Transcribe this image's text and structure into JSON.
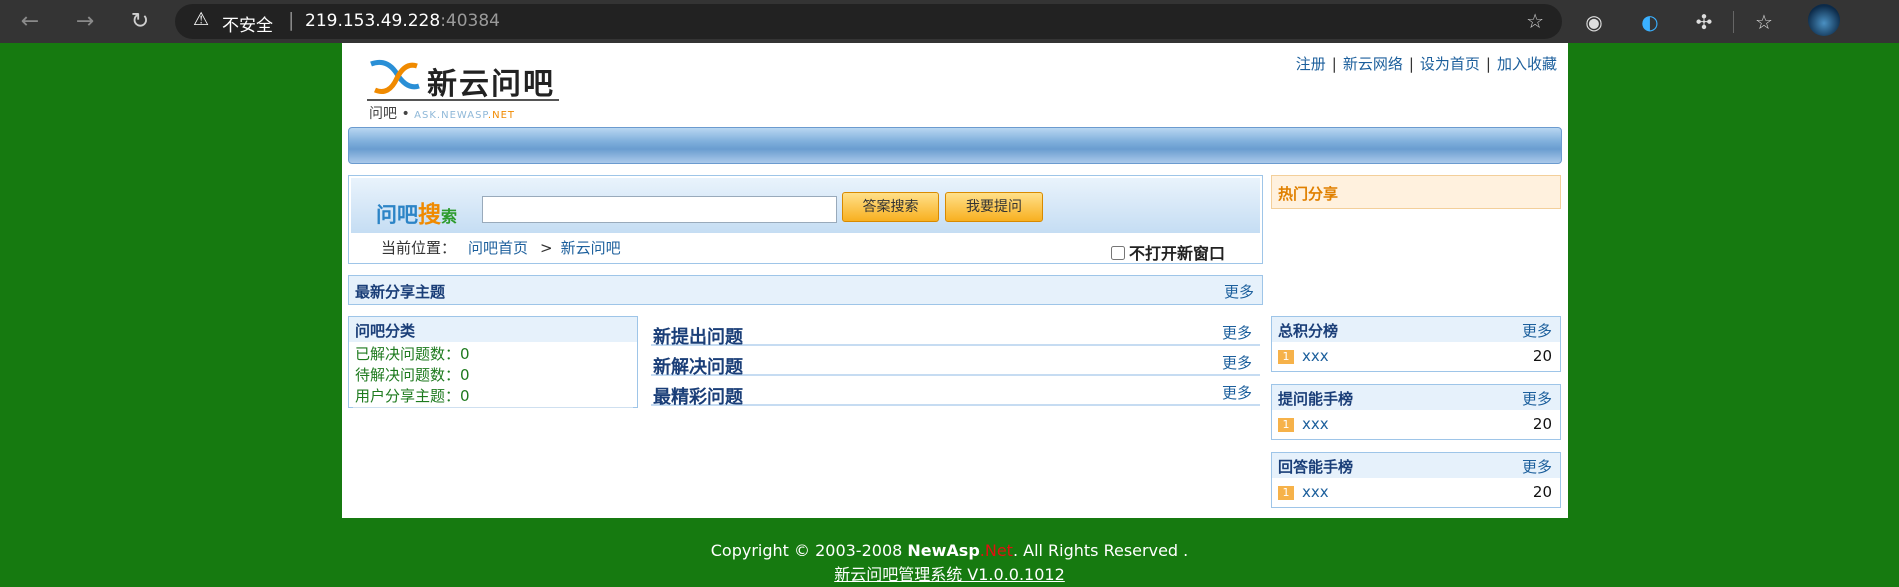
{
  "browser": {
    "insecure_label": "不安全",
    "host": "219.153.49.228",
    "port": ":40384"
  },
  "header": {
    "logo_title": "新云问吧",
    "logo_sub_prefix": "问吧 •",
    "logo_sub_url": "ASK.NEWASP",
    "logo_sub_net": ".NET",
    "links": [
      "注册",
      "新云网络",
      "设为首页",
      "加入收藏"
    ]
  },
  "search": {
    "title_a": "问吧",
    "title_b": "搜",
    "title_c": "索",
    "input_value": "",
    "answer_button": "答案搜索",
    "ask_button": "我要提问",
    "crumb_label": "当前位置：",
    "crumb_home": "问吧首页",
    "crumb_current": "新云问吧",
    "newwin_label": "不打开新窗口"
  },
  "hot_share": {
    "title": "热门分享"
  },
  "latest": {
    "title": "最新分享主题",
    "more": "更多"
  },
  "category": {
    "title": "问吧分类",
    "rows": [
      "已解决问题数：0",
      "待解决问题数：0",
      "用户分享主题：0"
    ]
  },
  "questions": [
    {
      "title": "新提出问题",
      "more": "更多"
    },
    {
      "title": "新解决问题",
      "more": "更多"
    },
    {
      "title": "最精彩问题",
      "more": "更多"
    }
  ],
  "ranks": [
    {
      "title": "总积分榜",
      "more": "更多",
      "num": "1",
      "name": "xxx",
      "score": "20"
    },
    {
      "title": "提问能手榜",
      "more": "更多",
      "num": "1",
      "name": "xxx",
      "score": "20"
    },
    {
      "title": "回答能手榜",
      "more": "更多",
      "num": "1",
      "name": "xxx",
      "score": "20"
    }
  ],
  "footer": {
    "copyright_pre": "Copyright © 2003-2008 ",
    "brand": "NewAsp",
    "brand_net": ".Net",
    "copyright_post": ". All Rights Reserved .",
    "version": "新云问吧管理系统 V1.0.0.1012"
  }
}
